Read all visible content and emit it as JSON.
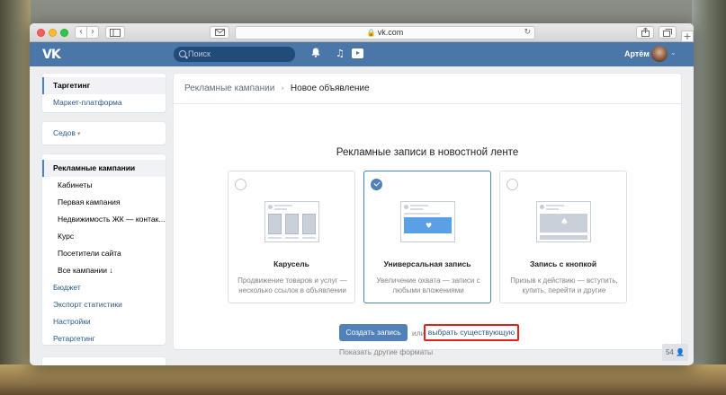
{
  "browser": {
    "url": "vk.com",
    "nav_back": "‹",
    "nav_forward": "›",
    "sidebar_icon": "sidebar-icon",
    "mail_icon": "mail-icon",
    "share_icon": "share-icon",
    "tabs_icon": "tabs-icon",
    "new_tab": "+"
  },
  "header": {
    "logo": "VK",
    "search_placeholder": "Поиск",
    "user_name": "Артём",
    "brand_color": "#4a76a8"
  },
  "left_menu": {
    "group1": [
      "Таргетинг",
      "Маркет-платформа"
    ],
    "group2": {
      "label": "Седов"
    },
    "group3": {
      "active": "Рекламные кампании",
      "sub_items": [
        "Кабинеты",
        "Первая кампания",
        "Недвижимость ЖК — контак...",
        "Курс",
        "Посетители сайта",
        "Все кампании ↓"
      ],
      "items": [
        "Бюджет",
        "Экспорт статистики",
        "Настройки",
        "Ретаргетинг"
      ]
    }
  },
  "main": {
    "breadcrumb_parent": "Рекламные кампании",
    "breadcrumb_current": "Новое объявление",
    "section_title": "Рекламные записи в новостной ленте",
    "formats": [
      {
        "title": "Карусель",
        "description": "Продвижение товаров и услуг — несколько ссылок в объявлении",
        "selected": false
      },
      {
        "title": "Универсальная запись",
        "description": "Увеличение охвата — записи с любыми вложениями",
        "selected": true
      },
      {
        "title": "Запись с кнопкой",
        "description": "Призыв к действию — вступить, купить, перейти и другие",
        "selected": false
      }
    ],
    "create_button": "Создать запись",
    "or_text": "или",
    "choose_existing": "выбрать существующую",
    "other_formats": "Показать другие форматы",
    "highlight_color": "#e0231a"
  },
  "counter": {
    "value": "54",
    "icon": "person-icon"
  }
}
